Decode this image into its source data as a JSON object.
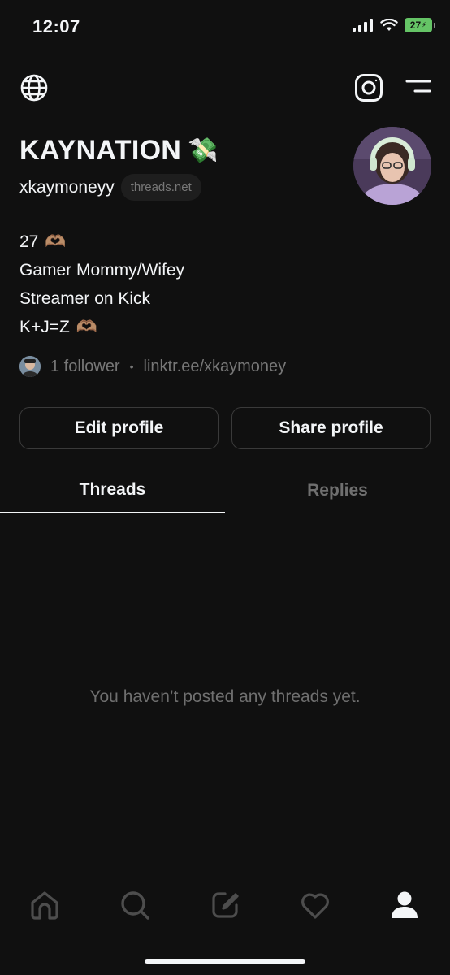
{
  "status_bar": {
    "time": "12:07",
    "battery": "27"
  },
  "profile": {
    "display_name": "KAYNATION",
    "name_emoji": "💸",
    "handle": "xkaymoneyy",
    "domain_pill": "threads.net",
    "bio": [
      {
        "text": "27",
        "emoji": "🫶🏽"
      },
      {
        "text": "Gamer Mommy/Wifey",
        "emoji": ""
      },
      {
        "text": "Streamer on Kick",
        "emoji": ""
      },
      {
        "text": "K+J=Z",
        "emoji": "🫶🏽"
      }
    ],
    "followers_text": "1 follower",
    "separator": "•",
    "link": "linktr.ee/xkaymoney"
  },
  "buttons": {
    "edit_label": "Edit profile",
    "share_label": "Share profile"
  },
  "tabs": [
    {
      "label": "Threads",
      "active": true
    },
    {
      "label": "Replies",
      "active": false
    }
  ],
  "empty_state": "You haven’t posted any threads yet.",
  "bottom_nav": [
    {
      "icon": "home-icon",
      "active": false
    },
    {
      "icon": "search-icon",
      "active": false
    },
    {
      "icon": "compose-icon",
      "active": false
    },
    {
      "icon": "heart-icon",
      "active": false
    },
    {
      "icon": "profile-icon",
      "active": true
    }
  ],
  "colors": {
    "background": "#101010",
    "text": "#f3f5f7",
    "muted": "#777777",
    "battery": "#65c466"
  }
}
